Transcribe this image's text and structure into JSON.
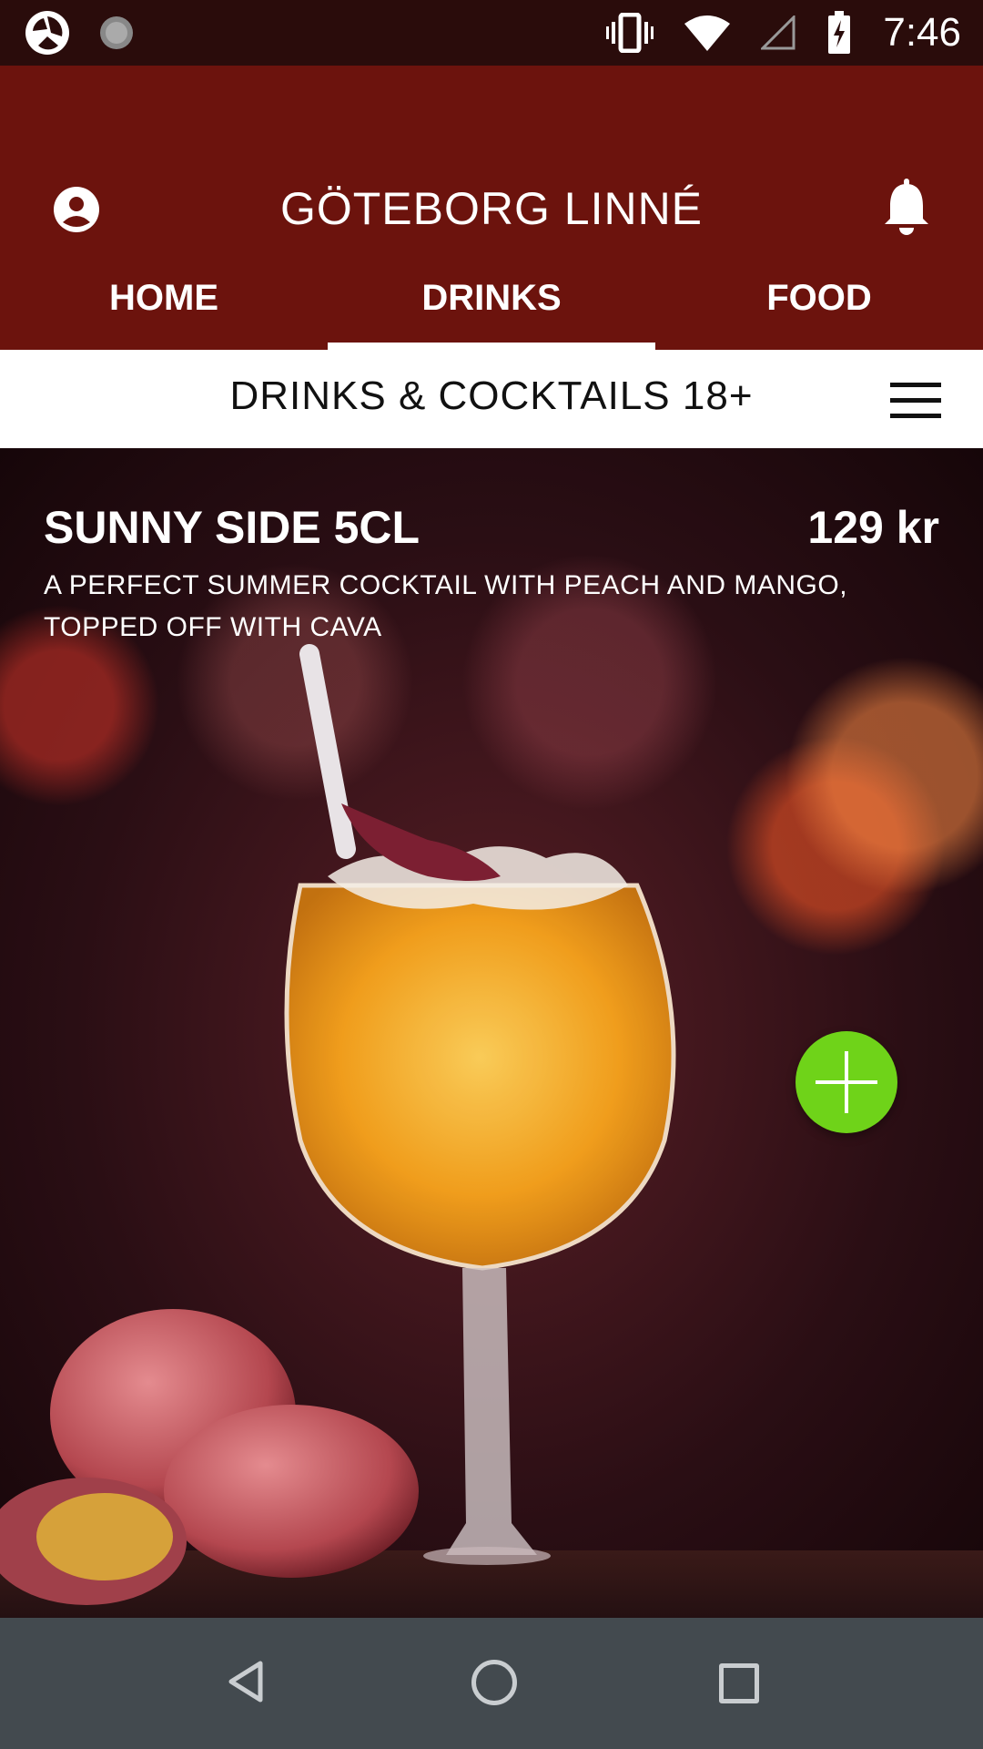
{
  "status_bar": {
    "time": "7:46",
    "icons": [
      "app-logo-icon",
      "loading-icon",
      "vibrate-icon",
      "wifi-icon",
      "signal-icon",
      "battery-charging-icon"
    ]
  },
  "header": {
    "title": "GÖTEBORG LINNÉ",
    "profile_icon": "account-circle-icon",
    "notification_icon": "bell-icon"
  },
  "tabs": [
    {
      "label": "HOME",
      "active": false
    },
    {
      "label": "DRINKS",
      "active": true
    },
    {
      "label": "FOOD",
      "active": false
    }
  ],
  "category": {
    "title": "DRINKS & COCKTAILS 18+",
    "menu_icon": "hamburger-menu-icon"
  },
  "item": {
    "name": "SUNNY SIDE 5CL",
    "price": "129 kr",
    "description": "A PERFECT SUMMER COCKTAIL WITH PEACH AND MANGO, TOPPED OFF WITH CAVA",
    "add_icon": "plus-icon",
    "add_color": "#6fd319"
  },
  "nav": {
    "icons": [
      "back-icon",
      "home-icon",
      "recent-apps-icon"
    ]
  },
  "colors": {
    "header_bg": "#6c130d",
    "status_bg": "#2a0c0b",
    "nav_bg": "#434a4f"
  }
}
